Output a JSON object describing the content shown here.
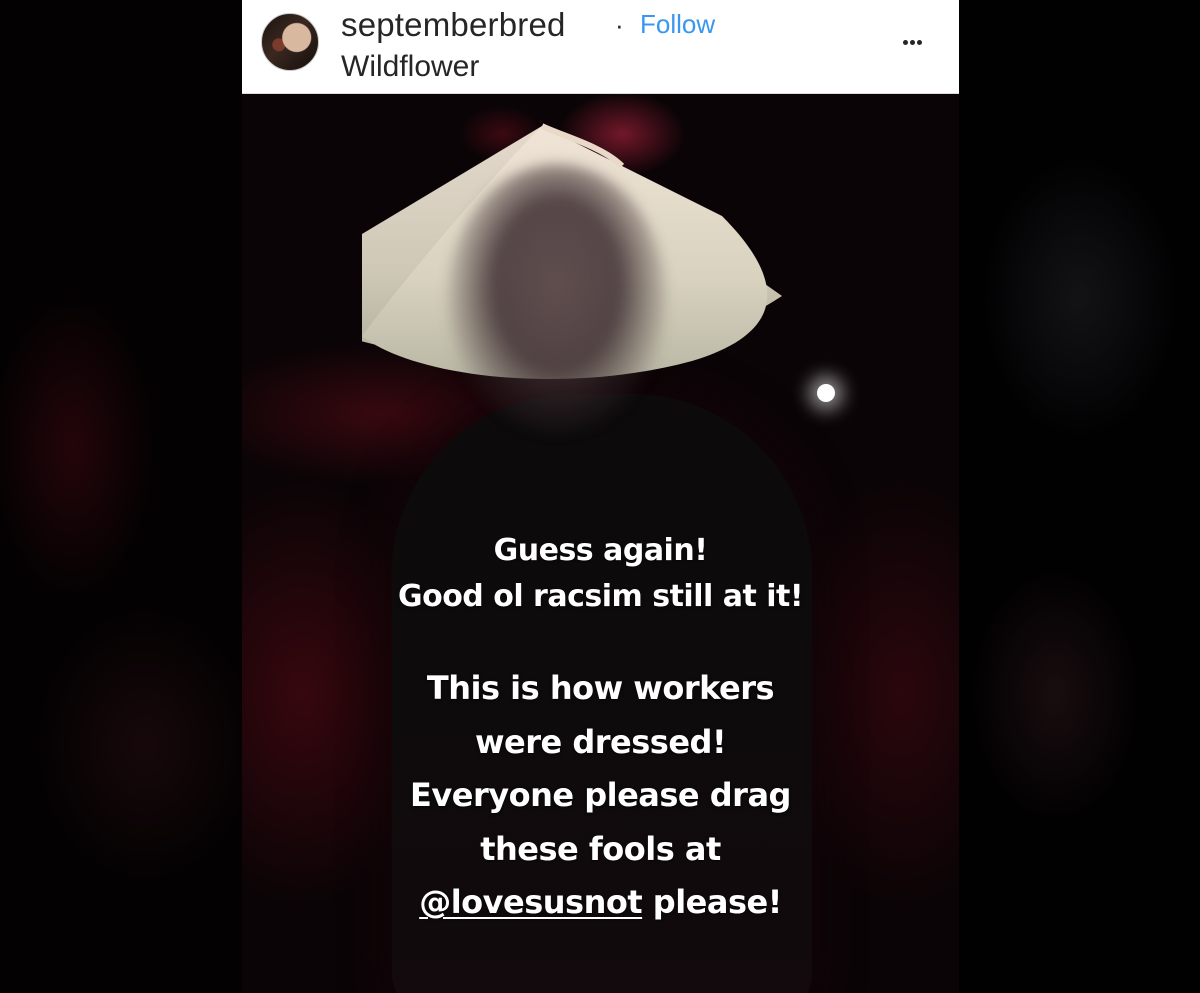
{
  "post": {
    "username": "septemberbred",
    "separator": "·",
    "follow_label": "Follow",
    "location": "Wildflower",
    "more_label": "..."
  },
  "caption": {
    "block1": [
      "Guess again!",
      "Good ol racsim still at it!"
    ],
    "block2": [
      "This is how workers",
      "were dressed!",
      "Everyone please drag",
      "these fools at"
    ],
    "mention": "@lovesusnot",
    "mention_suffix": " please!"
  },
  "colors": {
    "follow_link": "#3897f0",
    "header_bg": "#ffffff",
    "text_dark": "#262626",
    "caption_text": "#ffffff"
  },
  "icons": {
    "avatar": "profile-avatar",
    "more": "more-options-icon"
  }
}
